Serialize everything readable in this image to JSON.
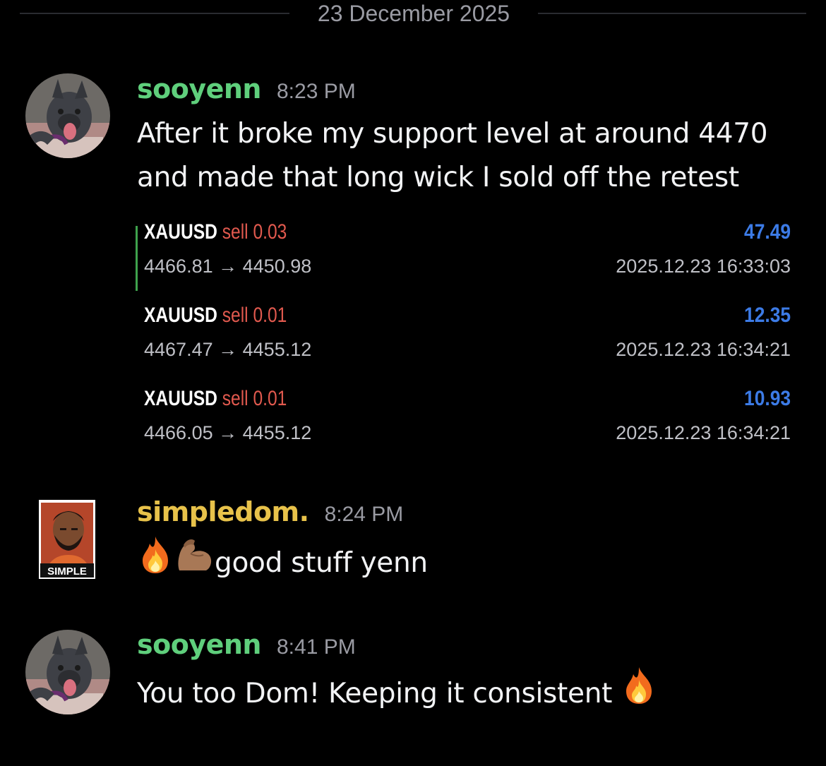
{
  "date_divider": "23 December 2025",
  "messages": [
    {
      "username": "sooyenn",
      "username_color": "#5fcf7c",
      "time": "8:23 PM",
      "text": "After it broke my support level at around 4470 and made that long wick I sold off the retest",
      "trades": [
        {
          "symbol": "XAUUSD",
          "side": "sell",
          "lot": "0.03",
          "open": "4466.81",
          "close": "4450.98",
          "arrow": "→",
          "profit": "47.49",
          "datetime": "2025.12.23 16:33:03"
        },
        {
          "symbol": "XAUUSD",
          "side": "sell",
          "lot": "0.01",
          "open": "4467.47",
          "close": "4455.12",
          "arrow": "→",
          "profit": "12.35",
          "datetime": "2025.12.23 16:34:21"
        },
        {
          "symbol": "XAUUSD",
          "side": "sell",
          "lot": "0.01",
          "open": "4466.05",
          "close": "4455.12",
          "arrow": "→",
          "profit": "10.93",
          "datetime": "2025.12.23 16:34:21"
        }
      ]
    },
    {
      "username": "simpledom.",
      "username_color": "#e8c24a",
      "time": "8:24 PM",
      "text": "good stuff yenn",
      "avatar_label": "SIMPLE",
      "emojis": [
        "fire-emoji",
        "flexed-biceps-emoji"
      ]
    },
    {
      "username": "sooyenn",
      "username_color": "#5fcf7c",
      "time": "8:41 PM",
      "text": "You too Dom! Keeping it consistent",
      "emojis": [
        "fire-emoji"
      ]
    }
  ]
}
